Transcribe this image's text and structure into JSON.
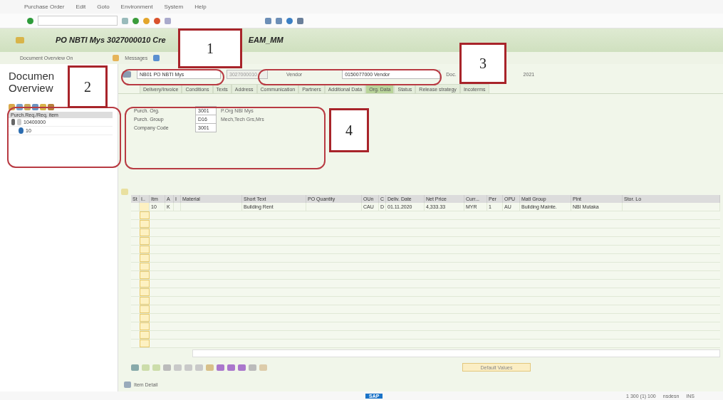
{
  "menu": [
    "Purchase Order",
    "Edit",
    "Goto",
    "Environment",
    "System",
    "Help"
  ],
  "title_start": "PO NBTI Mys 3027000010 Cre",
  "title_end": "EAM_MM",
  "app_toolbar": {
    "overview": "Document Overview On",
    "messages": "Messages"
  },
  "side_title": "Documen",
  "side_title2": "Overview",
  "tree": {
    "column": "Purch.Req./Req. item",
    "nodes": [
      {
        "label": "10400000",
        "expanded": true,
        "children": [
          {
            "label": "10"
          }
        ]
      }
    ]
  },
  "header": {
    "doc_type": "NB01 PO NBTI Mys",
    "doc_number": "3027000010",
    "vendor_label": "Vendor",
    "vendor": "0150077000 Vendor",
    "date_label": "Doc.",
    "date_tail": "2021"
  },
  "tabs": [
    {
      "label": "Delivery/Invoice",
      "selected": false
    },
    {
      "label": "Conditions",
      "selected": false
    },
    {
      "label": "Texts",
      "selected": false
    },
    {
      "label": "Address",
      "selected": false
    },
    {
      "label": "Communication",
      "selected": false
    },
    {
      "label": "Partners",
      "selected": false
    },
    {
      "label": "Additional Data",
      "selected": false
    },
    {
      "label": "Org. Data",
      "selected": true
    },
    {
      "label": "Status",
      "selected": false
    },
    {
      "label": "Release strategy",
      "selected": false
    },
    {
      "label": "Incoterms",
      "selected": false
    }
  ],
  "org_data": [
    {
      "label": "Purch. Org.",
      "code": "3001",
      "text": "P.Org NBI Mys"
    },
    {
      "label": "Purch. Group",
      "code": "D16",
      "text": "Mech,Tech Grs,Mrs"
    },
    {
      "label": "Company Code",
      "code": "3001"
    }
  ],
  "items": {
    "columns": [
      "St",
      "I..",
      "Itm",
      "A",
      "I",
      "Material",
      "Short Text",
      "PO Quantity",
      "OUn",
      "C",
      "Deliv. Date",
      "Net Price",
      "Curr...",
      "Per",
      "OPU",
      "Matl Group",
      "Plnt",
      "Stor. Lo"
    ],
    "rows": [
      [
        "",
        "",
        "10",
        "K",
        "",
        "",
        "Building Rent",
        "",
        "CAU",
        "D",
        "01.11.2020",
        "4,333.33",
        "MYR",
        "1",
        "AU",
        "Building Mainte.",
        "NBI Mutaka",
        ""
      ]
    ]
  },
  "default_values": "Default Values",
  "item_detail": "Item Detail",
  "status_logo": "SAP",
  "status_text": "1 300 (1) 100",
  "status_user": "nsdesn",
  "status_mode": "INS",
  "annotations": [
    {
      "label": "1"
    },
    {
      "label": "2"
    },
    {
      "label": "3"
    },
    {
      "label": "4"
    }
  ]
}
